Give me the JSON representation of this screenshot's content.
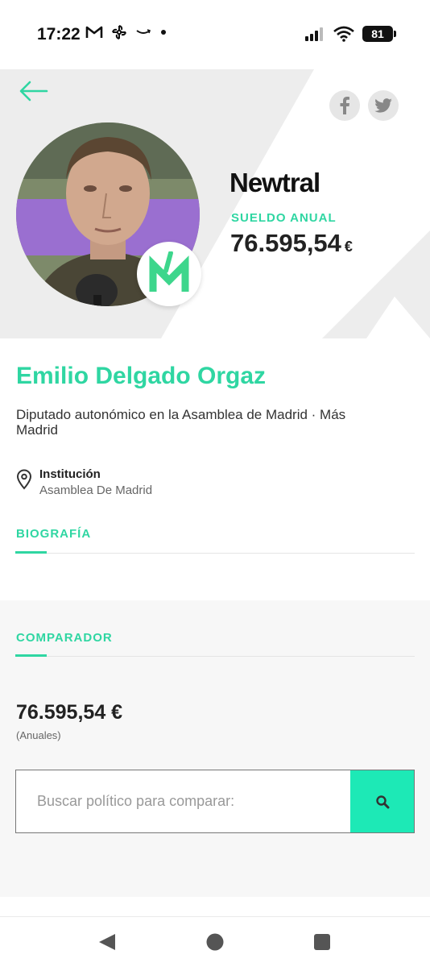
{
  "status_bar": {
    "time": "17:22",
    "left_icons": [
      "gmail-icon",
      "pinwheel-icon",
      "amazon-icon",
      "dot-icon"
    ],
    "battery": "81"
  },
  "hero": {
    "brand": "Newtral",
    "brand_accent": "#2fd6a2",
    "salary_label": "SUELDO ANUAL",
    "salary_value": "76.595,54",
    "salary_currency": "€",
    "party_logo_letter": "M",
    "party_color": "#3dd68c"
  },
  "profile": {
    "name": "Emilio Delgado Orgaz",
    "role": "Diputado autonómico en la Asamblea de Madrid · Más Madrid",
    "institution_title": "Institución",
    "institution_value": "Asamblea De Madrid"
  },
  "tabs": {
    "biografia": "BIOGRAFÍA",
    "comparador": "COMPARADOR"
  },
  "comparator": {
    "value": "76.595,54 €",
    "period": "(Anuales)",
    "search_placeholder": "Buscar político para comparar:"
  },
  "colors": {
    "accent": "#2fd6a2",
    "search_button": "#1de9b6"
  }
}
